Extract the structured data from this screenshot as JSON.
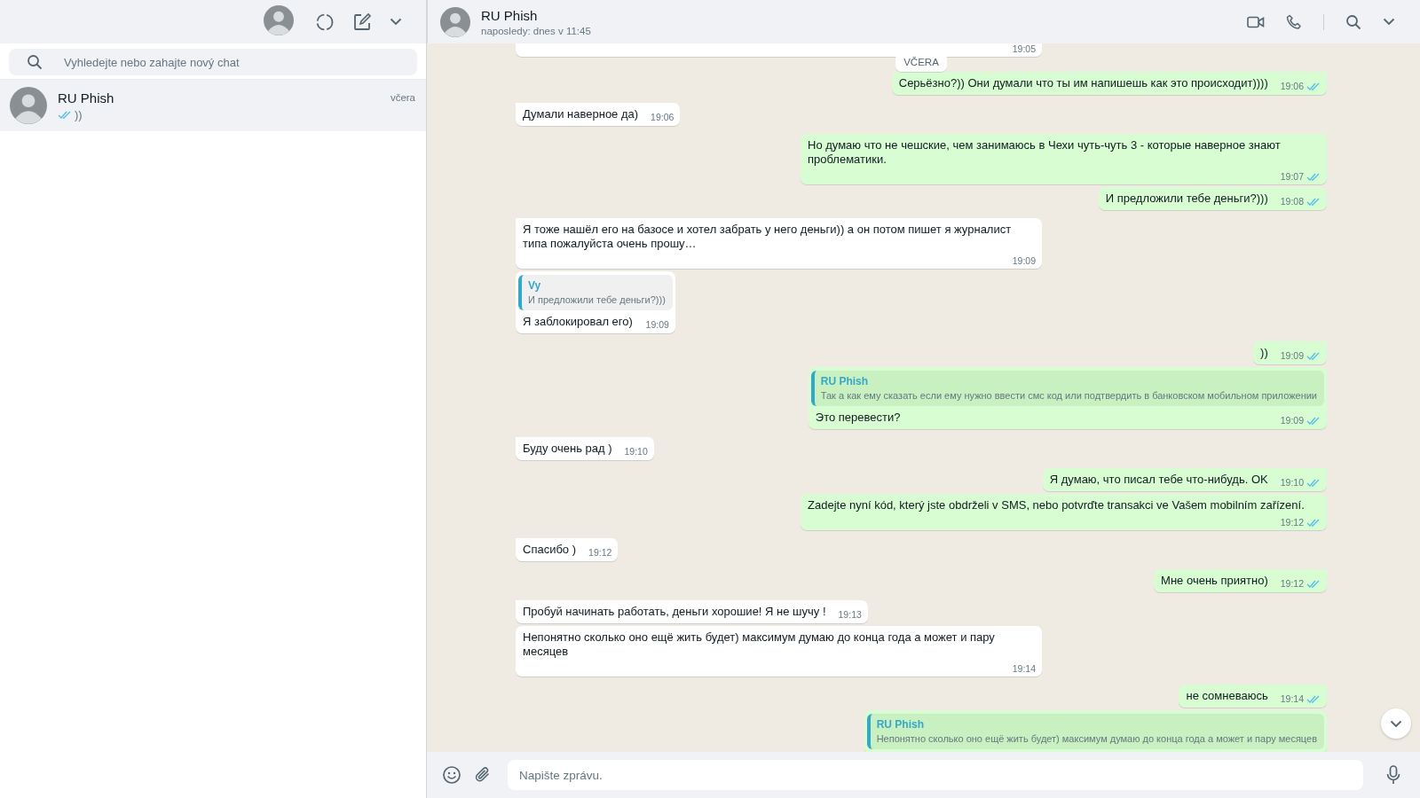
{
  "sidebar": {
    "search": {
      "placeholder": "Vyhledejte nebo zahajte nový chat"
    },
    "chats": [
      {
        "name": "RU Phish",
        "time": "včera",
        "preview": "))",
        "read": true,
        "selected": true
      }
    ]
  },
  "chat": {
    "title": "RU Phish",
    "status": "naposledy: dnes v 11:45",
    "messages": [
      {
        "kind": "in",
        "time": "19:05"
      },
      {
        "kind": "date",
        "text": "VČERA"
      },
      {
        "kind": "out",
        "text": "Серьёзно?)) Они думали что ты им напишешь как это происходит))))",
        "time": "19:06",
        "read": true
      },
      {
        "kind": "in",
        "text": "Думали наверное да)",
        "time": "19:06"
      },
      {
        "kind": "out",
        "text": "Но думаю что не чешские, чем занимаюсь в Чехи чуть-чуть 3 - которые наверное знают проблематики.",
        "time": "19:07",
        "read": true
      },
      {
        "kind": "out",
        "text": "И предложили тебе деньги?)))",
        "time": "19:08",
        "read": true
      },
      {
        "kind": "in",
        "text": "Я тоже нашёл его на базосе и хотел забрать у него деньги)) а он потом пишет я журналист типа пожалуйста очень прошу…",
        "time": "19:09"
      },
      {
        "kind": "in",
        "quote": {
          "author": "Vy",
          "text": "И предложили тебе деньги?)))"
        },
        "text": "Я заблокировал его)",
        "time": "19:09"
      },
      {
        "kind": "out",
        "text": "))",
        "time": "19:09",
        "read": true
      },
      {
        "kind": "out",
        "quote": {
          "author": "RU Phish",
          "text": "Так а как ему сказать если ему нужно ввести смс код или подтвердить в банковском мобильном приложении"
        },
        "text": "Это перевести?",
        "time": "19:09",
        "read": true
      },
      {
        "kind": "in",
        "text": "Буду очень рад )",
        "time": "19:10"
      },
      {
        "kind": "out",
        "text": "Я думаю, что писал тебе что-нибудь. OK",
        "time": "19:10",
        "read": true
      },
      {
        "kind": "out",
        "text": "Zadejte nyní kód, který jste obdrželi v SMS, nebo potvrďte transakci ve Vašem mobilním zařízení.",
        "time": "19:12",
        "read": true
      },
      {
        "kind": "in",
        "text": "Спасибо )",
        "time": "19:12"
      },
      {
        "kind": "out",
        "text": "Мне очень приятно)",
        "time": "19:12",
        "read": true
      },
      {
        "kind": "in",
        "text": "Пробуй начинать работать, деньги хорошие! Я не шучу !",
        "time": "19:13"
      },
      {
        "kind": "in",
        "text": "Непонятно сколько оно ещё жить будет) максимум думаю до конца года а может и пару месяцев",
        "time": "19:14"
      },
      {
        "kind": "out",
        "text": "не сомневаюсь",
        "time": "19:14",
        "read": true
      },
      {
        "kind": "out",
        "quote": {
          "author": "RU Phish",
          "text": "Непонятно сколько оно ещё жить будет) максимум думаю до конца года а может и пару месяцев"
        }
      }
    ],
    "composer": {
      "placeholder": "Napište zprávu."
    }
  }
}
